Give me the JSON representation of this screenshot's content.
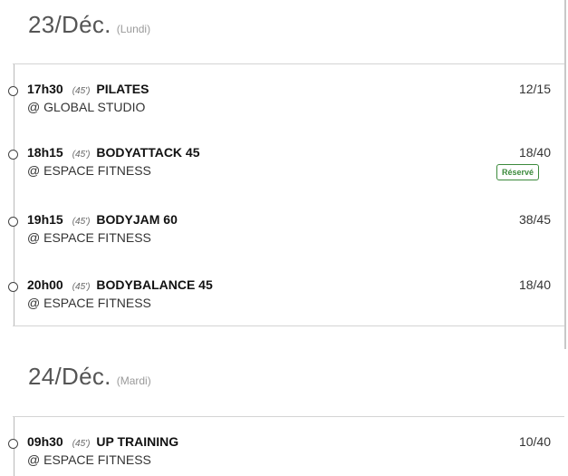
{
  "days": [
    {
      "date": "23/Déc.",
      "weekday": "(Lundi)",
      "sessions": [
        {
          "time": "17h30",
          "duration": "(45')",
          "name": "PILATES",
          "location": "@ GLOBAL STUDIO",
          "count": "12/15"
        },
        {
          "time": "18h15",
          "duration": "(45')",
          "name": "BODYATTACK 45",
          "location": "@ ESPACE FITNESS",
          "count": "18/40",
          "badge": "Réservé"
        },
        {
          "time": "19h15",
          "duration": "(45')",
          "name": "BODYJAM 60",
          "location": "@ ESPACE FITNESS",
          "count": "38/45"
        },
        {
          "time": "20h00",
          "duration": "(45')",
          "name": "BODYBALANCE 45",
          "location": "@ ESPACE FITNESS",
          "count": "18/40"
        }
      ]
    },
    {
      "date": "24/Déc.",
      "weekday": "(Mardi)",
      "sessions": [
        {
          "time": "09h30",
          "duration": "(45')",
          "name": "UP TRAINING",
          "location": "@ ESPACE FITNESS",
          "count": "10/40"
        }
      ]
    }
  ],
  "colors": {
    "accent_green": "#3c8a3c",
    "rule": "#d4d4d4",
    "header_text": "#555555"
  }
}
